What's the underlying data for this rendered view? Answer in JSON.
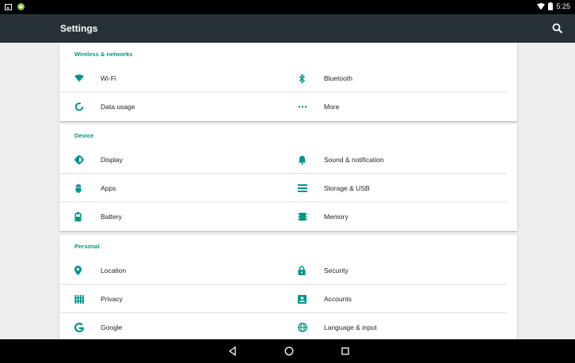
{
  "status_bar": {
    "time": "5:25",
    "left_icons": [
      "image-notification-icon",
      "android-notification-icon"
    ],
    "right_icons": [
      "wifi-icon",
      "battery-icon"
    ]
  },
  "app_bar": {
    "title": "Settings",
    "search_icon": "search-icon"
  },
  "sections": [
    {
      "title": "Wireless & networks",
      "items": [
        {
          "label": "Wi-Fi",
          "icon": "wifi-icon"
        },
        {
          "label": "Bluetooth",
          "icon": "bluetooth-icon"
        },
        {
          "label": "Data usage",
          "icon": "data-usage-icon"
        },
        {
          "label": "More",
          "icon": "more-icon"
        }
      ]
    },
    {
      "title": "Device",
      "items": [
        {
          "label": "Display",
          "icon": "display-icon"
        },
        {
          "label": "Sound & notification",
          "icon": "bell-icon"
        },
        {
          "label": "Apps",
          "icon": "android-icon"
        },
        {
          "label": "Storage & USB",
          "icon": "storage-icon"
        },
        {
          "label": "Battery",
          "icon": "battery-icon"
        },
        {
          "label": "Memory",
          "icon": "memory-icon"
        }
      ]
    },
    {
      "title": "Personal",
      "items": [
        {
          "label": "Location",
          "icon": "location-icon"
        },
        {
          "label": "Security",
          "icon": "lock-icon"
        },
        {
          "label": "Privacy",
          "icon": "privacy-icon"
        },
        {
          "label": "Accounts",
          "icon": "account-icon"
        },
        {
          "label": "Google",
          "icon": "google-icon"
        },
        {
          "label": "Language & input",
          "icon": "globe-icon"
        }
      ]
    }
  ],
  "nav_bar": {
    "back_icon": "back-icon",
    "home_icon": "home-icon",
    "recents_icon": "recents-icon"
  },
  "colors": {
    "accent": "#009688",
    "app_bar": "#263238",
    "background": "#eeeeee",
    "card": "#ffffff",
    "text": "#212121"
  }
}
